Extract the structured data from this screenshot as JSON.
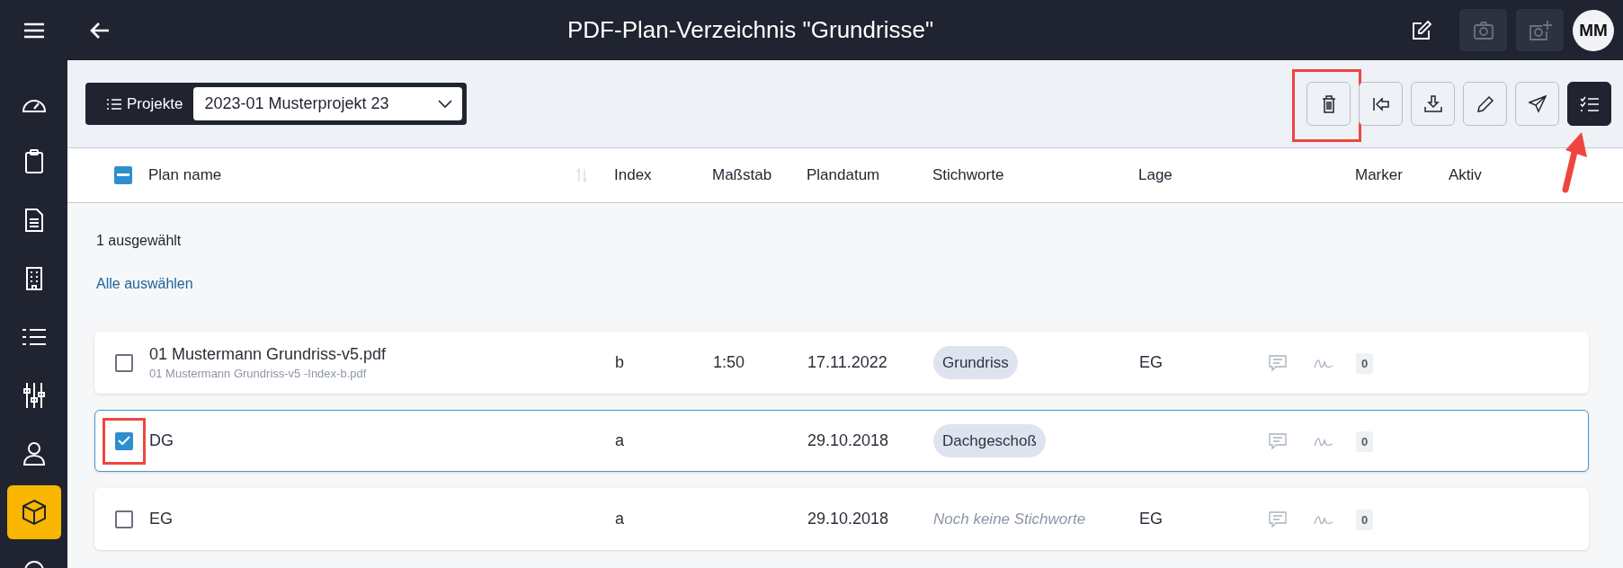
{
  "sidebar": {
    "items": [
      {
        "kind": "gauge",
        "selected": false
      },
      {
        "kind": "clipboard",
        "selected": false
      },
      {
        "kind": "document",
        "selected": false
      },
      {
        "kind": "building",
        "selected": false
      },
      {
        "kind": "list",
        "selected": false
      },
      {
        "kind": "sliders",
        "selected": false
      },
      {
        "kind": "person",
        "selected": false
      },
      {
        "kind": "box",
        "selected": true
      },
      {
        "kind": "circle",
        "selected": false
      }
    ]
  },
  "top_bar": {
    "title": "PDF-Plan-Verzeichnis \"Grundrisse\"",
    "avatar": "MM"
  },
  "project_selector": {
    "label": "Projekte",
    "value": "2023-01 Musterprojekt 23"
  },
  "toolbar": [
    {
      "kind": "delete",
      "highlighted": true,
      "arrow": false,
      "dark": false
    },
    {
      "kind": "import",
      "highlighted": false,
      "arrow": false,
      "dark": false
    },
    {
      "kind": "download",
      "highlighted": false,
      "arrow": false,
      "dark": false
    },
    {
      "kind": "edit",
      "highlighted": false,
      "arrow": false,
      "dark": false
    },
    {
      "kind": "send",
      "highlighted": false,
      "arrow": false,
      "dark": false
    },
    {
      "kind": "checklist",
      "highlighted": false,
      "arrow": true,
      "dark": true
    }
  ],
  "table": {
    "select_all_partial": true,
    "columns": [
      "Plan name",
      "Index",
      "Maßstab",
      "Plandatum",
      "Stichworte",
      "Lage",
      "Marker",
      "Aktiv"
    ],
    "selection_count": "1 ausgewählt",
    "select_all_link": "Alle auswählen",
    "rows": [
      {
        "name": "01 Mustermann Grundriss-v5.pdf",
        "file": "01 Mustermann Grundriss-v5 -Index-b.pdf",
        "index": "b",
        "scale": "1:50",
        "date": "17.11.2022",
        "tags": [
          "Grundriss"
        ],
        "location": "EG",
        "markers": "0",
        "selected": false,
        "highlighted": false
      },
      {
        "name": "DG",
        "index": "a",
        "date": "29.10.2018",
        "tags": [
          "Dachgeschoß"
        ],
        "markers": "0",
        "selected": true,
        "highlighted": true
      },
      {
        "name": "EG",
        "index": "a",
        "date": "29.10.2018",
        "tags": [],
        "no_tags": "Noch keine Stichworte",
        "location": "EG",
        "markers": "0",
        "selected": false,
        "highlighted": false
      }
    ]
  }
}
